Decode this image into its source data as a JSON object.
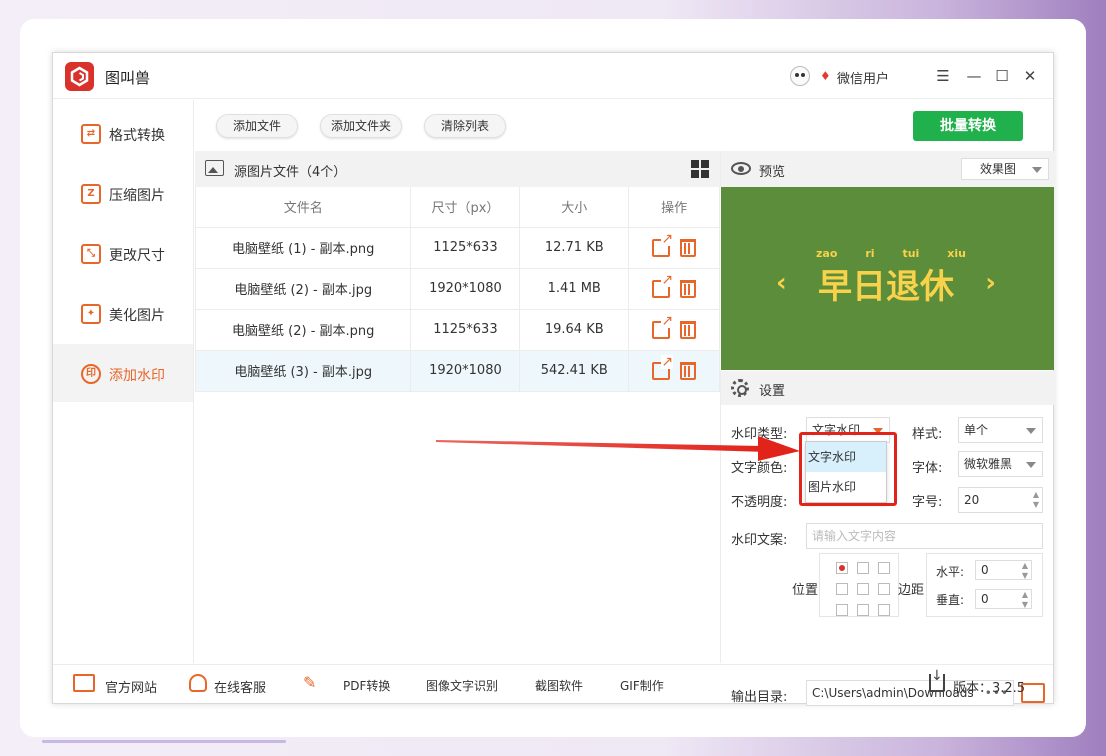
{
  "app": {
    "title": "图叫兽",
    "user_name": "微信用户",
    "icons": [
      "logo-icon",
      "avatar",
      "vip-icon",
      "menu-icon",
      "minimize-icon",
      "maximize-icon",
      "close-icon"
    ]
  },
  "sidebar": {
    "items": [
      {
        "label": "格式转换",
        "icon": "format-convert-icon",
        "active": false
      },
      {
        "label": "压缩图片",
        "icon": "compress-icon",
        "active": false
      },
      {
        "label": "更改尺寸",
        "icon": "resize-icon",
        "active": false
      },
      {
        "label": "美化图片",
        "icon": "beautify-icon",
        "active": false
      },
      {
        "label": "添加水印",
        "icon": "watermark-icon",
        "active": true
      }
    ]
  },
  "toolbar": {
    "add_file": "添加文件",
    "add_folder": "添加文件夹",
    "clear_list": "清除列表",
    "batch_convert": "批量转换"
  },
  "file_list": {
    "title": "源图片文件（4个）",
    "columns": [
      "文件名",
      "尺寸（px）",
      "大小",
      "操作"
    ],
    "rows": [
      {
        "name": "电脑壁纸 (1) - 副本.png",
        "dims": "1125*633",
        "size": "12.71 KB",
        "selected": false
      },
      {
        "name": "电脑壁纸 (2) - 副本.jpg",
        "dims": "1920*1080",
        "size": "1.41 MB",
        "selected": false
      },
      {
        "name": "电脑壁纸 (2) - 副本.png",
        "dims": "1125*633",
        "size": "19.64 KB",
        "selected": false
      },
      {
        "name": "电脑壁纸 (3) - 副本.jpg",
        "dims": "1920*1080",
        "size": "542.41 KB",
        "selected": true
      }
    ]
  },
  "preview": {
    "title": "预览",
    "mode": "效果图",
    "image": {
      "pinyin": [
        "zao",
        "ri",
        "tui",
        "xiu"
      ],
      "text": "早日退休",
      "left_arrow": "‹",
      "right_arrow": "›",
      "bg_color": "#5c8d3b",
      "text_color": "#f7d24a"
    }
  },
  "settings": {
    "title": "设置",
    "watermark_type_label": "水印类型:",
    "watermark_type_value": "文字水印",
    "text_color_label": "文字颜色:",
    "opacity_label": "不透明度:",
    "style_label": "样式:",
    "style_value": "单个",
    "font_label": "字体:",
    "font_value": "微软雅黑",
    "font_size_label": "字号:",
    "font_size_value": "20",
    "watermark_text_label": "水印文案:",
    "watermark_text_placeholder": "请输入文字内容",
    "position_label": "位置",
    "margin_label": "边距",
    "horizontal_label": "水平:",
    "horizontal_value": "0",
    "vertical_label": "垂直:",
    "vertical_value": "0",
    "output_label": "输出目录:",
    "output_path": "C:\\Users\\admin\\Downloads",
    "browse": "•••"
  },
  "dropdown": {
    "options": [
      "文字水印",
      "图片水印"
    ]
  },
  "footer": {
    "website": "官方网站",
    "support": "在线客服",
    "pdf": "PDF转换",
    "ocr": "图像文字识别",
    "screenshot": "截图软件",
    "gif": "GIF制作",
    "version": "版本：3.2.5"
  },
  "colors": {
    "accent": "#e9662a",
    "primary_button": "#20b14c",
    "highlight_box": "#e2231a"
  }
}
